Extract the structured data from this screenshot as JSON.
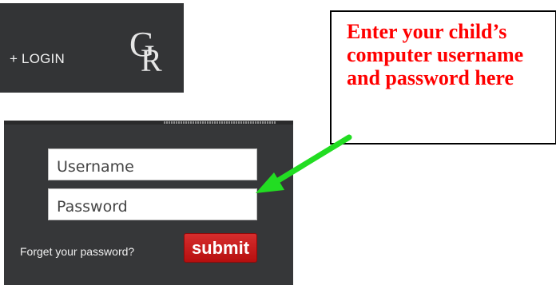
{
  "header": {
    "login_label": "+ LOGIN",
    "logo_letters": {
      "top": "G",
      "bottom": "R"
    }
  },
  "login_form": {
    "username_placeholder": "Username",
    "password_placeholder": "Password",
    "forgot_label": "Forget your password?",
    "submit_label": "submit"
  },
  "callout": {
    "text": "Enter your child’s computer username and password here"
  },
  "colors": {
    "panel_bg": "#363739",
    "submit_red": "#c81d1d",
    "callout_text": "#ff0000",
    "arrow_green": "#22dd22"
  }
}
